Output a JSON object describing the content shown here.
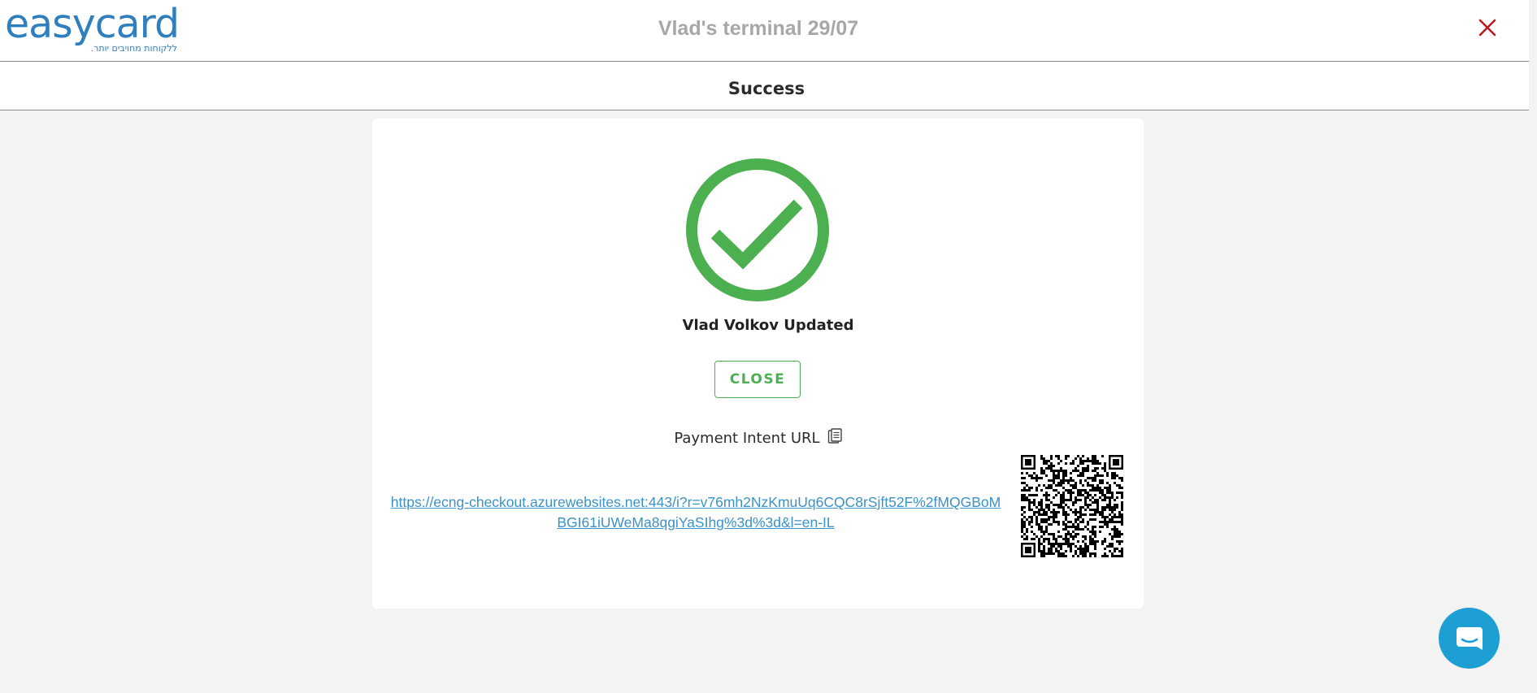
{
  "header": {
    "logo_text": "easycard",
    "logo_tagline": "ללקוחות מחויבים יותר.",
    "terminal_title": "Vlad's terminal 29/07",
    "close_icon": "close-x-icon"
  },
  "subheader": {
    "title": "Success"
  },
  "result": {
    "status_icon": "check-circle-icon",
    "message": "Vlad Volkov Updated",
    "close_button_label": "CLOSE"
  },
  "payment_intent": {
    "label": "Payment Intent URL",
    "copy_icon": "clipboard-icon",
    "url": "https://ecng-checkout.azurewebsites.net:443/i?r=v76mh2NzKmuUq6CQC8rSjft52F%2fMQGBoMBGI61iUWeMa8qgiYaSIhg%3d%3d&l=en-IL",
    "qr_icon": "qr-code"
  },
  "chat": {
    "icon": "chat-bubble-icon"
  },
  "colors": {
    "brand_blue": "#2f7ebd",
    "success_green": "#4caf50",
    "close_red": "#b71c1c",
    "link_blue": "#3a92c8",
    "chat_blue": "#1e9fd4"
  }
}
